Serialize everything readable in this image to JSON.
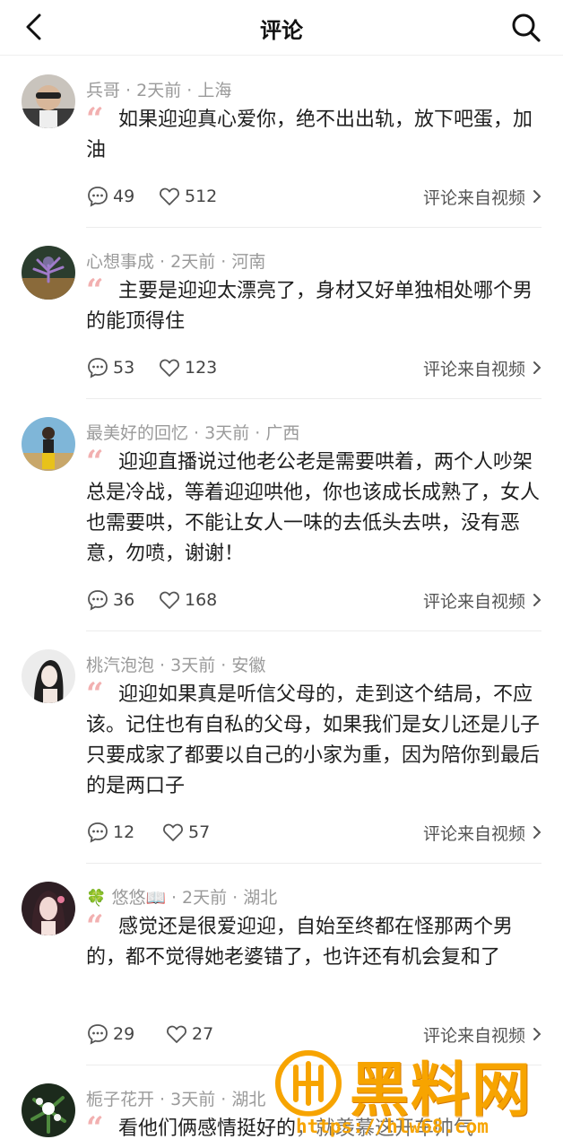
{
  "header": {
    "title": "评论"
  },
  "source_label": "评论来自视频",
  "comments": [
    {
      "user": "兵哥",
      "time": "2天前",
      "location": "上海",
      "text": "如果迎迎真心爱你，绝不出出轨，放下吧蛋，加油",
      "replies": "49",
      "likes": "512"
    },
    {
      "user": "心想事成",
      "time": "2天前",
      "location": "河南",
      "text": "主要是迎迎太漂亮了，身材又好单独相处哪个男的能顶得住",
      "replies": "53",
      "likes": "123"
    },
    {
      "user": "最美好的回忆",
      "time": "3天前",
      "location": "广西",
      "text": "迎迎直播说过他老公老是需要哄着，两个人吵架总是冷战，等着迎迎哄他，你也该成长成熟了，女人也需要哄，不能让女人一味的去低头去哄，没有恶意，勿喷，谢谢！",
      "replies": "36",
      "likes": "168"
    },
    {
      "user": "桃汽泡泡",
      "time": "3天前",
      "location": "安徽",
      "text": "迎迎如果真是听信父母的，走到这个结局，不应该。记住也有自私的父母，如果我们是女儿还是儿子只要成家了都要以自己的小家为重，因为陪你到最后的是两口子",
      "replies": "12",
      "likes": "57"
    },
    {
      "user_prefix": "🍀",
      "user": "悠悠",
      "user_suffix": "📖",
      "time": "2天前",
      "location": "湖北",
      "text": "感觉还是很爱迎迎，自始至终都在怪那两个男的，都不觉得她老婆错了，也许还有机会复和了",
      "replies": "29",
      "likes": "27"
    },
    {
      "user": "栀子花开",
      "time": "3天前",
      "location": "湖北",
      "text": "看他们俩感情挺好的，就羡慕这开车帅气",
      "replies": "",
      "likes": ""
    }
  ],
  "watermark": {
    "brand": "黑料网",
    "url": "https://hlw68.com"
  },
  "colors": {
    "quote": "#f2b0b0",
    "meta": "#9a9a9a",
    "watermark": "#f7a400"
  }
}
